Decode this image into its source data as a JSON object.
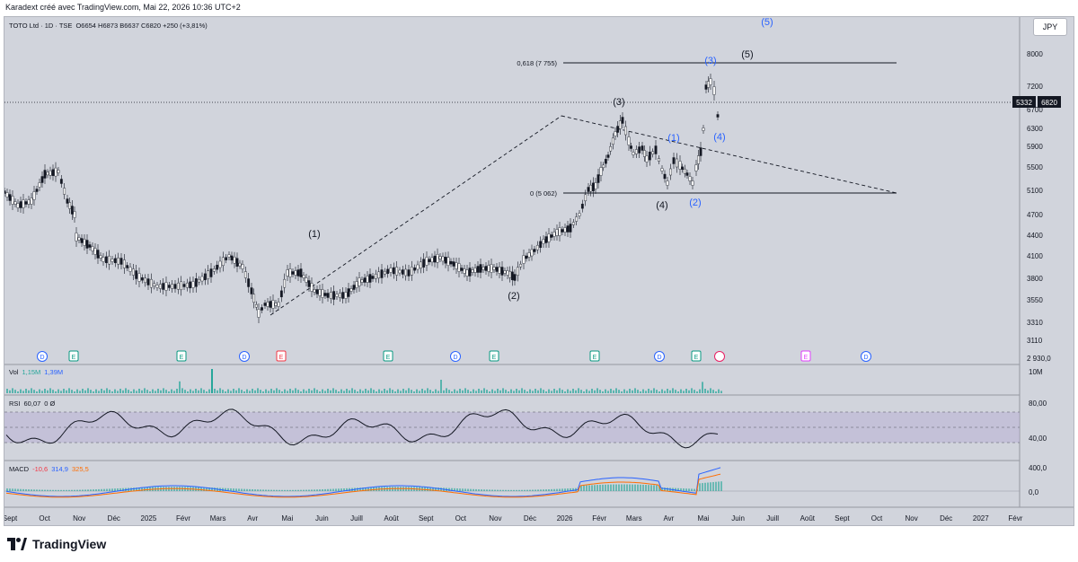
{
  "header": {
    "caption": "Karadext créé avec TradingView.com, Mai 22, 2026 10:36 UTC+2",
    "symbol": "TOTO Ltd · 1D · TSE",
    "ohlc": "O6654 H6873 B6637 C6820 +250 (+3,81%)"
  },
  "currency": "JPY",
  "brand": "TradingView",
  "price_axis": {
    "ticks": [
      "8000",
      "7200",
      "6700",
      "6300",
      "5900",
      "5500",
      "5100",
      "4700",
      "4400",
      "4100",
      "3800",
      "3550",
      "3310",
      "3110",
      "2 930,0"
    ],
    "last_price_left": "5332",
    "last_price_right": "6820"
  },
  "time_axis": [
    "Sept",
    "Oct",
    "Nov",
    "Déc",
    "2025",
    "Févr",
    "Mars",
    "Avr",
    "Mai",
    "Juin",
    "Juill",
    "Août",
    "Sept",
    "Oct",
    "Nov",
    "Déc",
    "2026",
    "Févr",
    "Mars",
    "Avr",
    "Mai",
    "Juin",
    "Juill",
    "Août",
    "Sept",
    "Oct",
    "Nov",
    "Déc",
    "2027",
    "Févr"
  ],
  "fib": {
    "upper_label": "0,618 (7 755)",
    "lower_label": "0 (5 062)"
  },
  "waves_black": [
    "(1)",
    "(2)",
    "(3)",
    "(4)",
    "(5)"
  ],
  "waves_blue": [
    "(1)",
    "(2)",
    "(3)",
    "(4)",
    "(5)"
  ],
  "events": [
    "D",
    "E",
    "E",
    "D",
    "E",
    "E",
    "D",
    "E",
    "E",
    "D",
    "E",
    "E",
    "D"
  ],
  "volume": {
    "label": "Vol",
    "v1": "1,15M",
    "v2": "1,39M",
    "scale": "10M"
  },
  "rsi": {
    "label": "RSI",
    "value": "60,07",
    "extra": "0 Ø",
    "top": "80,00",
    "bottom": "40,00"
  },
  "macd": {
    "label": "MACD",
    "v1": "-10,6",
    "v2": "314,9",
    "v3": "325,5",
    "top": "400,0",
    "bottom": "0,0"
  },
  "colors": {
    "panel_bg": "#d1d4dc",
    "wave_blue": "#2962ff",
    "event_green": "#089981",
    "event_red": "#f23645",
    "event_blue": "#2962ff",
    "macd_blue": "#2962ff",
    "macd_orange": "#ff6d00",
    "vol_green": "#26a69a",
    "rsi_band": "#b9b0d6"
  }
}
